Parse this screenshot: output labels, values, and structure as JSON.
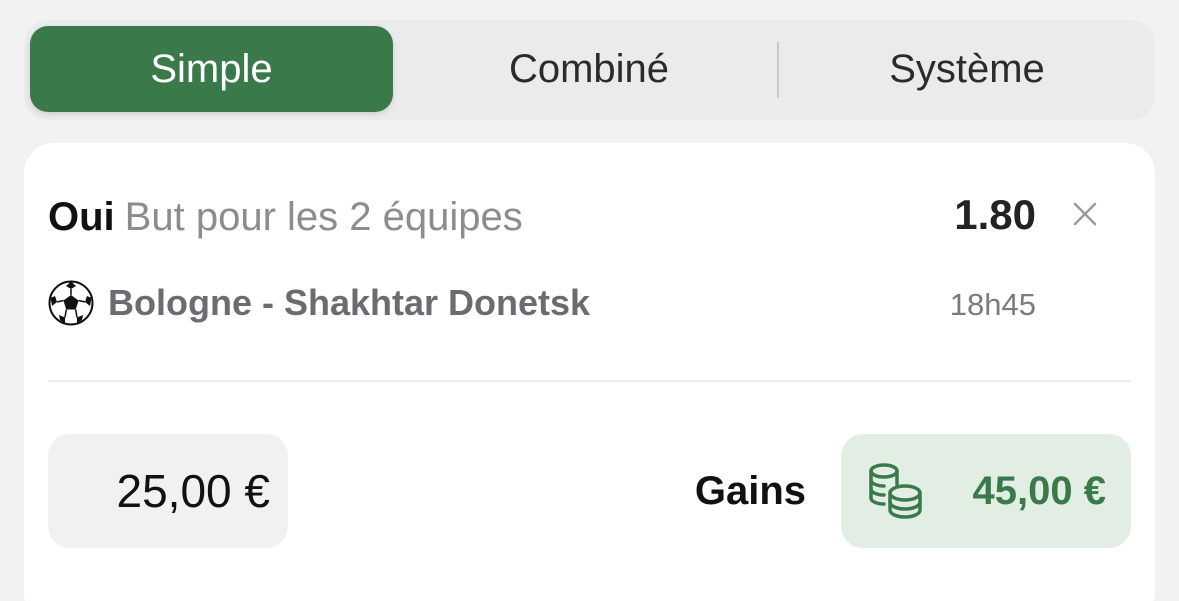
{
  "tabs": [
    {
      "label": "Simple",
      "active": true
    },
    {
      "label": "Combiné",
      "active": false
    },
    {
      "label": "Système",
      "active": false
    }
  ],
  "bet": {
    "pick": "Oui",
    "market": "But pour les 2 équipes",
    "odds": "1.80",
    "sport_icon": "soccer-ball-icon",
    "match": "Bologne - Shakhtar Donetsk",
    "time": "18h45"
  },
  "stake": {
    "value": "25,00 €"
  },
  "gains": {
    "label": "Gains",
    "icon": "coins-icon",
    "value": "45,00 €"
  },
  "colors": {
    "accent": "#3a7a4a",
    "gains_bg": "#e2ede4",
    "page_bg": "#f2f2f3"
  }
}
